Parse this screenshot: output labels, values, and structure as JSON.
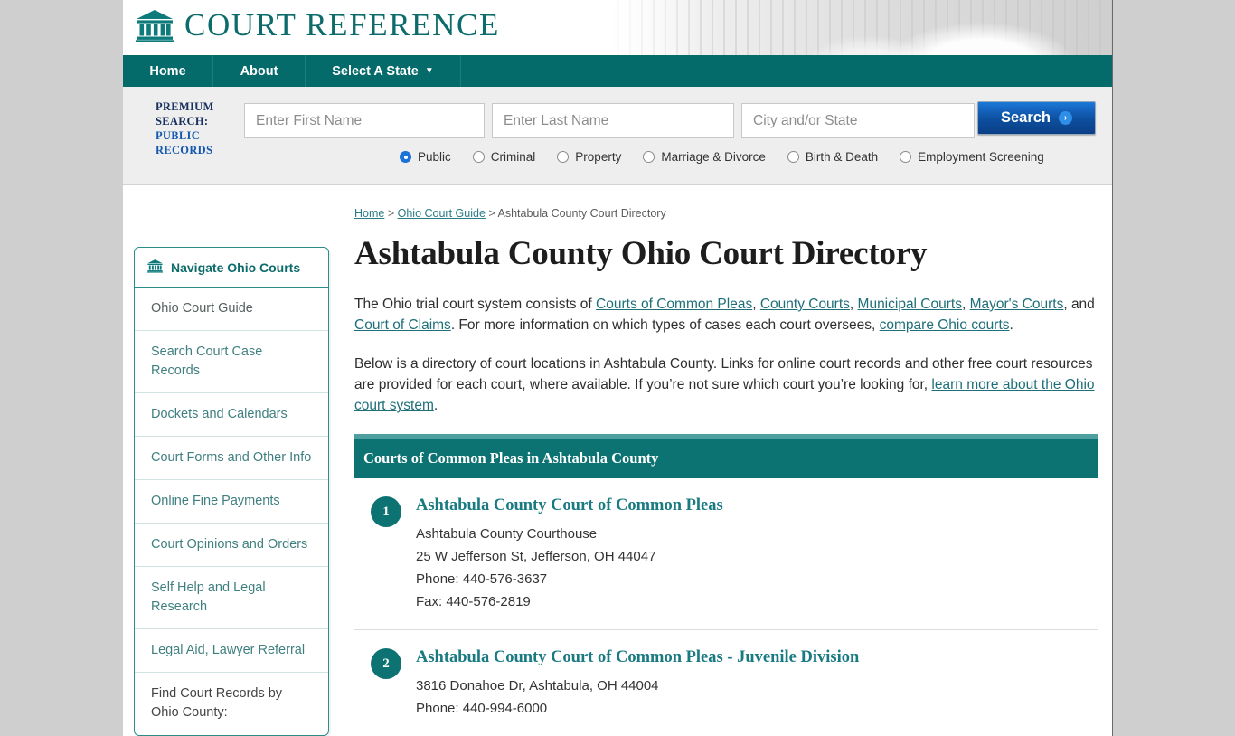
{
  "site": {
    "brand": "COURT REFERENCE",
    "logo_icon": "courthouse-icon"
  },
  "nav": {
    "items": [
      {
        "label": "Home"
      },
      {
        "label": "About"
      },
      {
        "label": "Select A State",
        "caret": "▼"
      }
    ]
  },
  "premium_search": {
    "label_line1": "PREMIUM",
    "label_line2": "SEARCH:",
    "label_line3": "PUBLIC",
    "label_line4": "RECORDS",
    "first_name_placeholder": "Enter First Name",
    "first_name_value": "",
    "last_name_placeholder": "Enter Last Name",
    "last_name_value": "",
    "city_state_placeholder": "City and/or State",
    "city_state_value": "",
    "search_button": "Search",
    "search_arrow": "›",
    "radios": [
      {
        "label": "Public",
        "selected": true
      },
      {
        "label": "Criminal",
        "selected": false
      },
      {
        "label": "Property",
        "selected": false
      },
      {
        "label": "Marriage & Divorce",
        "selected": false
      },
      {
        "label": "Birth & Death",
        "selected": false
      },
      {
        "label": "Employment Screening",
        "selected": false
      }
    ]
  },
  "sidebar": {
    "header": "Navigate Ohio Courts",
    "header_icon": "courthouse-icon",
    "items": [
      {
        "label": "Ohio Court Guide"
      },
      {
        "label": "Search Court Case Records"
      },
      {
        "label": "Dockets and Calendars"
      },
      {
        "label": "Court Forms and Other Info"
      },
      {
        "label": "Online Fine Payments"
      },
      {
        "label": "Court Opinions and Orders"
      },
      {
        "label": "Self Help and Legal Research"
      },
      {
        "label": "Legal Aid, Lawyer Referral"
      },
      {
        "label": "Find Court Records by Ohio County:"
      }
    ]
  },
  "breadcrumb": {
    "home": "Home",
    "guide": "Ohio Court Guide",
    "current": "Ashtabula County Court Directory",
    "sep": ">"
  },
  "main": {
    "title": "Ashtabula County Ohio Court Directory",
    "p1": {
      "t1": "The Ohio trial court system consists of ",
      "l1": "Courts of Common Pleas",
      "t2": ", ",
      "l2": "County Courts",
      "t3": ", ",
      "l3": "Municipal Courts",
      "t4": ", ",
      "l4": "Mayor's Courts",
      "t5": ", and ",
      "l5": "Court of Claims",
      "t6": ". For more information on which types of cases each court oversees, ",
      "l6": "compare Ohio courts",
      "t7": "."
    },
    "p2": {
      "t1": "Below is a directory of court locations in Ashtabula County. Links for online court records and other free court resources are provided for each court, where available. If you’re not sure which court you’re looking for, ",
      "l1": "learn more about the Ohio court system",
      "t2": "."
    },
    "section_title": "Courts of Common Pleas in Ashtabula County",
    "courts": [
      {
        "number": "1",
        "name": "Ashtabula County Court of Common Pleas",
        "lines": [
          "Ashtabula County Courthouse",
          "25 W Jefferson St, Jefferson, OH 44047",
          "Phone: 440-576-3637",
          "Fax: 440-576-2819"
        ]
      },
      {
        "number": "2",
        "name": "Ashtabula County Court of Common Pleas - Juvenile Division",
        "lines": [
          "3816 Donahoe Dr, Ashtabula, OH 44004",
          "Phone: 440-994-6000"
        ]
      }
    ]
  },
  "colors": {
    "teal": "#0c7272",
    "teal_light": "#4ea0a0",
    "link": "#1e6f78",
    "button_blue": "#0d4e9e",
    "page_bg": "#cfcfcf"
  }
}
